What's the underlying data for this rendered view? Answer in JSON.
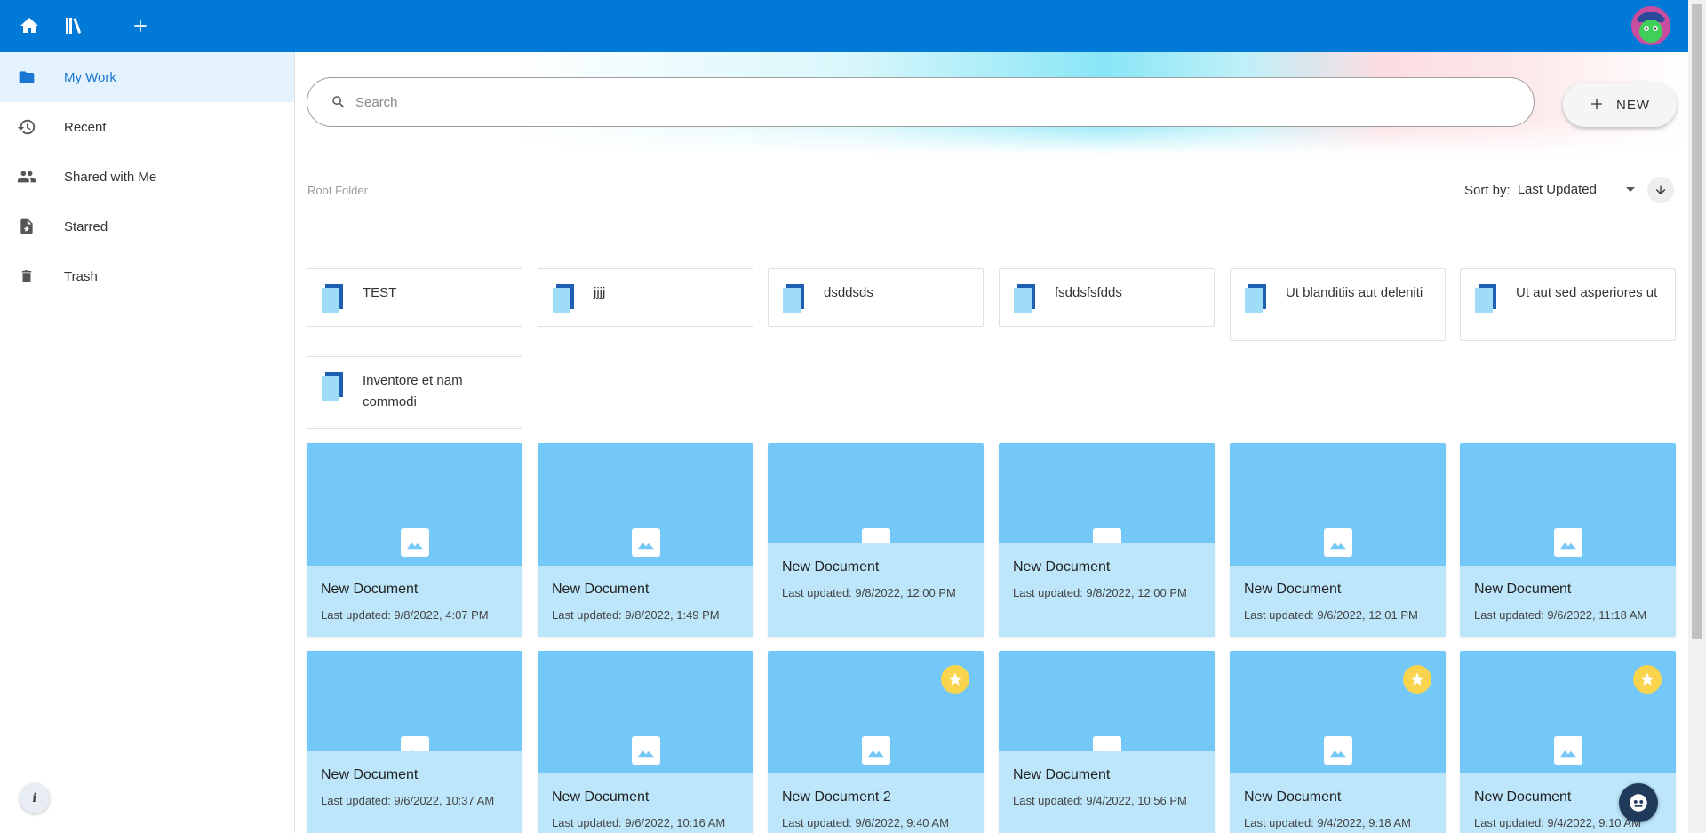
{
  "topbar": {
    "icons": [
      "home-icon",
      "library-icon",
      "add-icon"
    ],
    "accent": "#0179d6"
  },
  "sidebar": {
    "items": [
      {
        "label": "My Work",
        "icon": "folder-icon",
        "active": true
      },
      {
        "label": "Recent",
        "icon": "history-icon",
        "active": false
      },
      {
        "label": "Shared with Me",
        "icon": "people-icon",
        "active": false
      },
      {
        "label": "Starred",
        "icon": "starred-file-icon",
        "active": false
      },
      {
        "label": "Trash",
        "icon": "trash-icon",
        "active": false
      }
    ],
    "info_label": "i"
  },
  "search": {
    "placeholder": "Search"
  },
  "new_button": {
    "label": "NEW"
  },
  "breadcrumb": "Root Folder",
  "sort": {
    "label": "Sort by:",
    "value": "Last Updated",
    "direction": "descending"
  },
  "folders": [
    "TEST",
    "jjjj",
    "dsddsds",
    "fsddsfsfdds",
    "Ut blanditiis aut deleniti",
    "Ut aut sed asperiores ut",
    "Inventore et nam commodi"
  ],
  "documents": [
    {
      "title": "New Document",
      "updated": "Last updated: 9/8/2022, 4:07 PM",
      "starred": false
    },
    {
      "title": "New Document",
      "updated": "Last updated: 9/8/2022, 1:49 PM",
      "starred": false
    },
    {
      "title": "New Document",
      "updated": "Last updated: 9/8/2022, 12:00 PM",
      "starred": false
    },
    {
      "title": "New Document",
      "updated": "Last updated: 9/8/2022, 12:00 PM",
      "starred": false
    },
    {
      "title": "New Document",
      "updated": "Last updated: 9/6/2022, 12:01 PM",
      "starred": false
    },
    {
      "title": "New Document",
      "updated": "Last updated: 9/6/2022, 11:18 AM",
      "starred": false
    },
    {
      "title": "New Document",
      "updated": "Last updated: 9/6/2022, 10:37 AM",
      "starred": false
    },
    {
      "title": "New Document",
      "updated": "Last updated: 9/6/2022, 10:16 AM",
      "starred": false
    },
    {
      "title": "New Document 2",
      "updated": "Last updated: 9/6/2022, 9:40 AM",
      "starred": true
    },
    {
      "title": "New Document",
      "updated": "Last updated: 9/4/2022, 10:56 PM",
      "starred": false
    },
    {
      "title": "New Document",
      "updated": "Last updated: 9/4/2022, 9:18 AM",
      "starred": true
    },
    {
      "title": "New Document",
      "updated": "Last updated: 9/4/2022, 9:10 AM",
      "starred": true
    }
  ],
  "colors": {
    "card_thumb": "#74c8f8",
    "card_info": "#bde6fb",
    "star": "#f9d44c",
    "active_nav": "#e3f2fd"
  }
}
